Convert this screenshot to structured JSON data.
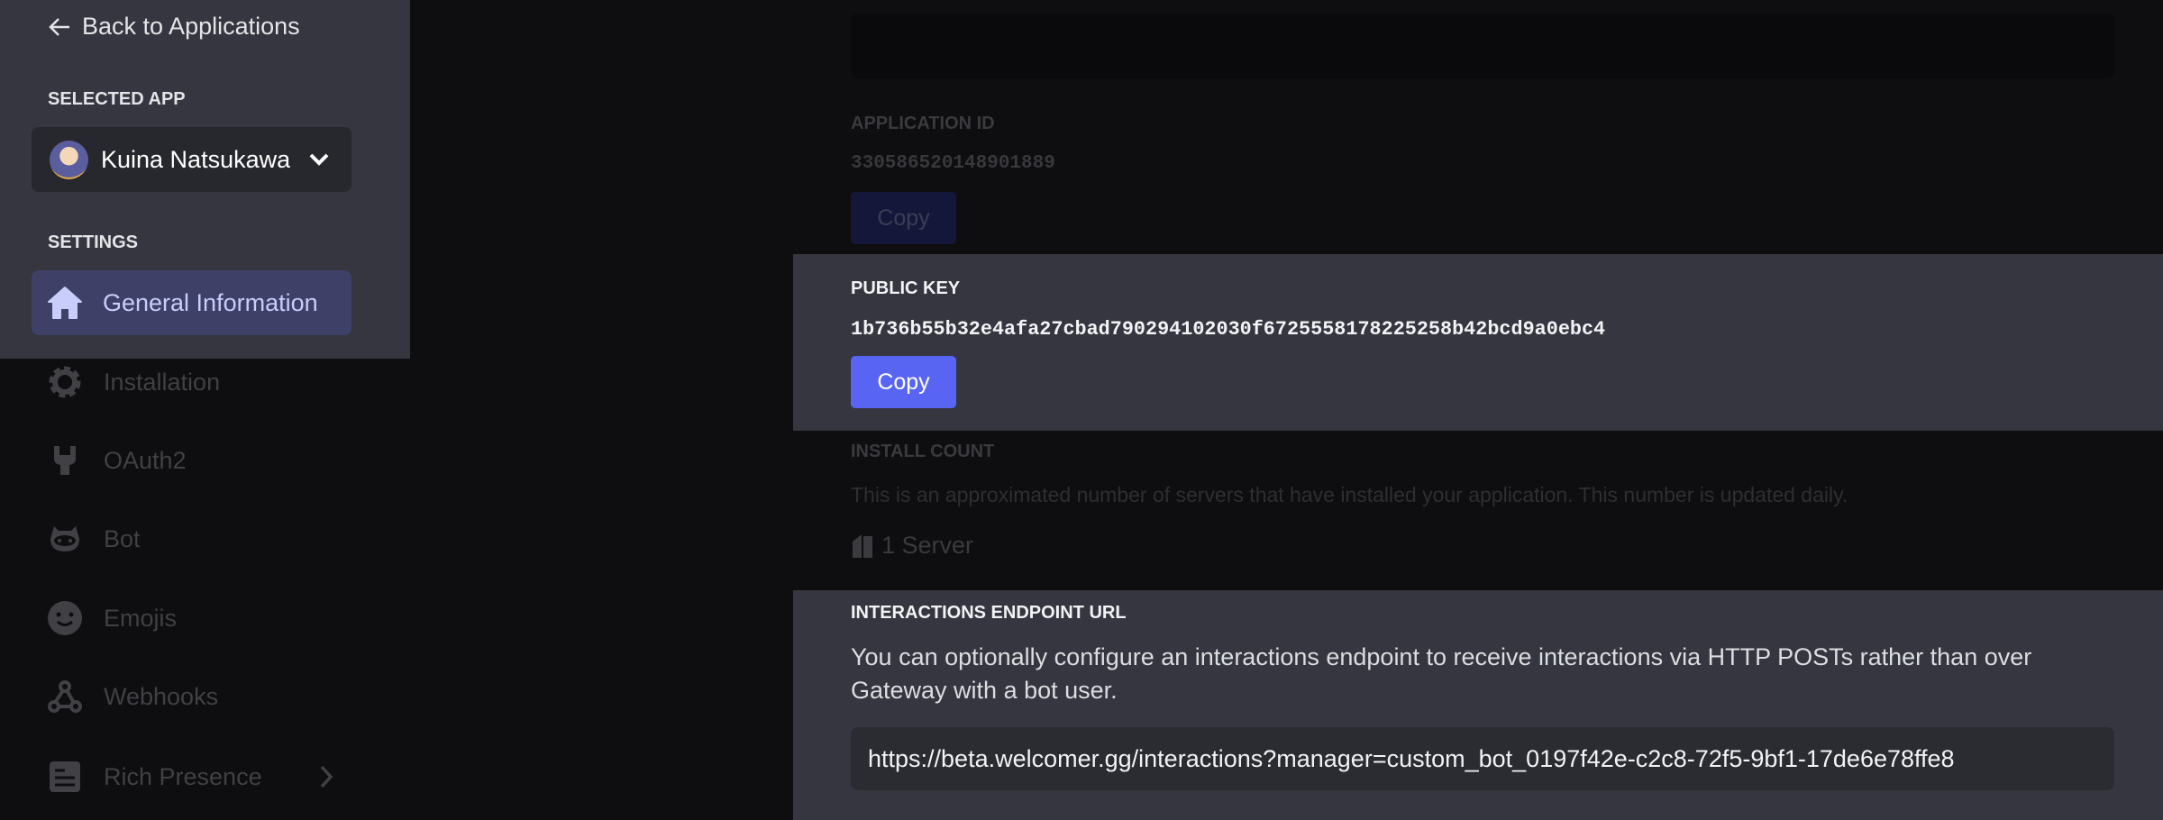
{
  "sidebar": {
    "back_label": "Back to Applications",
    "selected_app_heading": "SELECTED APP",
    "selected_app_name": "Kuina Natsukawa",
    "settings_heading": "SETTINGS",
    "items": [
      {
        "label": "General Information",
        "icon": "home-icon"
      },
      {
        "label": "Installation",
        "icon": "gear-icon"
      },
      {
        "label": "OAuth2",
        "icon": "wrench-icon"
      },
      {
        "label": "Bot",
        "icon": "bot-icon"
      },
      {
        "label": "Emojis",
        "icon": "smiley-icon"
      },
      {
        "label": "Webhooks",
        "icon": "webhook-icon"
      },
      {
        "label": "Rich Presence",
        "icon": "document-icon"
      }
    ]
  },
  "main": {
    "application_id": {
      "label": "APPLICATION ID",
      "value": "330586520148901889",
      "copy_label": "Copy"
    },
    "public_key": {
      "label": "PUBLIC KEY",
      "value": "1b736b55b32e4afa27cbad790294102030f6725558178225258b42bcd9a0ebc4",
      "copy_label": "Copy"
    },
    "install_count": {
      "label": "INSTALL COUNT",
      "description": "This is an approximated number of servers that have installed your application. This number is updated daily.",
      "value": "1 Server"
    },
    "interactions": {
      "label": "INTERACTIONS ENDPOINT URL",
      "description_line1": "You can optionally configure an interactions endpoint to receive interactions via HTTP POSTs rather than over",
      "description_line2": "Gateway with a bot user.",
      "url": "https://beta.welcomer.gg/interactions?manager=custom_bot_0197f42e-c2c8-72f5-9bf1-17de6e78ffe8"
    }
  },
  "colors": {
    "accent": "#5865f2",
    "panel": "#35363f",
    "background": "#0e0e10"
  }
}
